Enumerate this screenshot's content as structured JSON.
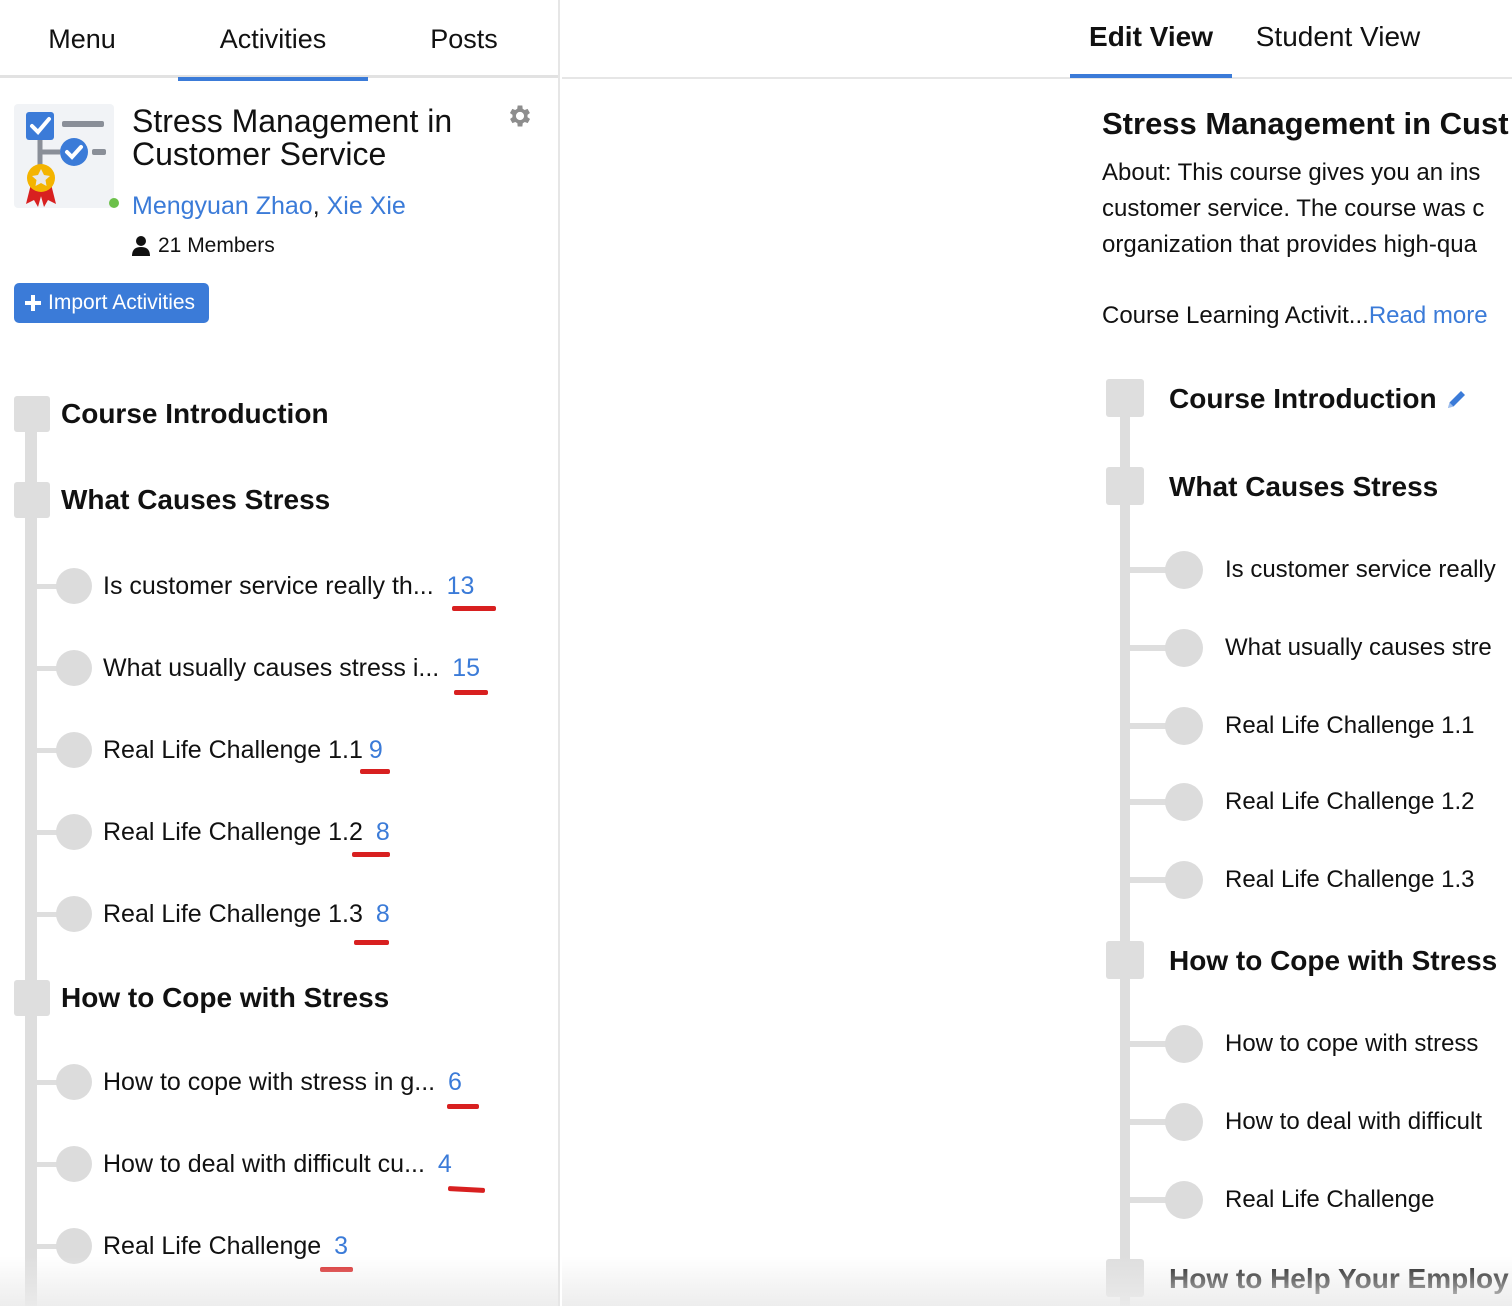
{
  "left": {
    "tabs": [
      {
        "label": "Menu"
      },
      {
        "label": "Activities"
      },
      {
        "label": "Posts"
      }
    ],
    "course": {
      "title": "Stress Management in Customer Service",
      "authors": [
        "Mengyuan Zhao",
        "Xie Xie"
      ],
      "author_separator": ",",
      "members": "21 Members"
    },
    "import_button": "Import Activities",
    "sections": [
      {
        "title": "Course Introduction",
        "items": []
      },
      {
        "title": "What Causes Stress",
        "items": [
          {
            "label": "Is customer service really th...",
            "count": "13"
          },
          {
            "label": "What usually causes stress i...",
            "count": "15"
          },
          {
            "label": "Real Life Challenge 1.1",
            "count": "9"
          },
          {
            "label": "Real Life Challenge 1.2",
            "count": "8"
          },
          {
            "label": "Real Life Challenge 1.3",
            "count": "8"
          }
        ]
      },
      {
        "title": "How to Cope with Stress",
        "items": [
          {
            "label": "How to cope with stress in g...",
            "count": "6"
          },
          {
            "label": "How to deal with difficult cu...",
            "count": "4"
          },
          {
            "label": "Real Life Challenge",
            "count": "3"
          }
        ]
      }
    ]
  },
  "right": {
    "tabs": [
      {
        "label": "Edit View"
      },
      {
        "label": "Student View"
      }
    ],
    "title": "Stress Management in Cust",
    "about_lines": [
      "About: This course gives you an ins",
      "customer service. The course was c",
      "organization that provides high-qua"
    ],
    "activities_text": "Course Learning Activit...",
    "read_more": "Read more",
    "sections": [
      {
        "title": "Course Introduction",
        "items": []
      },
      {
        "title": "What Causes Stress",
        "items": [
          "Is customer service really",
          "What usually causes stre",
          "Real Life Challenge 1.1",
          "Real Life Challenge 1.2",
          "Real Life Challenge 1.3"
        ]
      },
      {
        "title": "How to Cope with Stress",
        "items": [
          "How to cope with stress",
          "How to deal with difficult",
          "Real Life Challenge"
        ]
      },
      {
        "title": "How to Help Your Employ",
        "items": []
      }
    ]
  },
  "colors": {
    "accent": "#3b7bd8",
    "annotation_red": "#d82020",
    "timeline_gray": "#dedede",
    "online_green": "#6cc04a"
  }
}
